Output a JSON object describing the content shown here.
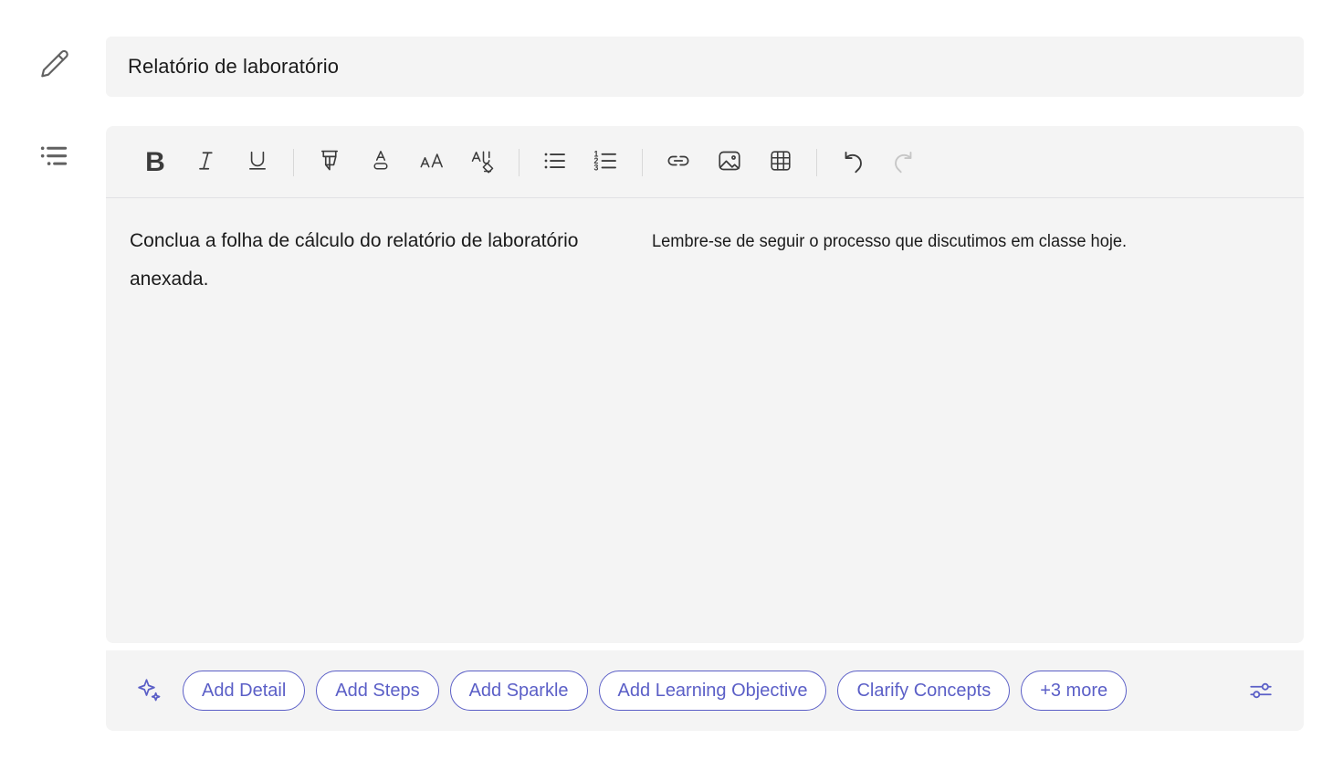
{
  "rail": {
    "edit_icon": "pencil-icon",
    "outline_icon": "bulleted-outline-icon"
  },
  "title_field": {
    "value": "Relatório de laboratório",
    "placeholder": "Título"
  },
  "toolbar": {
    "items": [
      {
        "name": "bold-button",
        "label": "B",
        "icon": "bold-icon",
        "disabled": false
      },
      {
        "name": "italic-button",
        "label": "",
        "icon": "italic-icon",
        "disabled": false
      },
      {
        "name": "underline-button",
        "label": "",
        "icon": "underline-icon",
        "disabled": false
      },
      {
        "name": "highlight-button",
        "label": "",
        "icon": "highlighter-icon",
        "disabled": false
      },
      {
        "name": "font-color-button",
        "label": "",
        "icon": "font-color-icon",
        "disabled": false
      },
      {
        "name": "font-size-button",
        "label": "",
        "icon": "font-size-icon",
        "disabled": false
      },
      {
        "name": "clear-formatting-button",
        "label": "",
        "icon": "clear-formatting-icon",
        "disabled": false
      },
      {
        "name": "bulleted-list-button",
        "label": "",
        "icon": "bulleted-list-icon",
        "disabled": false
      },
      {
        "name": "numbered-list-button",
        "label": "",
        "icon": "numbered-list-icon",
        "disabled": false
      },
      {
        "name": "insert-link-button",
        "label": "",
        "icon": "link-icon",
        "disabled": false
      },
      {
        "name": "insert-image-button",
        "label": "",
        "icon": "image-icon",
        "disabled": false
      },
      {
        "name": "insert-table-button",
        "label": "",
        "icon": "table-icon",
        "disabled": false
      },
      {
        "name": "undo-button",
        "label": "",
        "icon": "undo-icon",
        "disabled": false
      },
      {
        "name": "redo-button",
        "label": "",
        "icon": "redo-icon",
        "disabled": true
      }
    ]
  },
  "editor": {
    "paragraph_primary": "Conclua a folha de cálculo do relatório de laboratório anexada.",
    "paragraph_secondary": "Lembre-se de seguir o processo que discutimos em classe hoje."
  },
  "actions": {
    "sparkle_icon": "sparkle-icon",
    "settings_icon": "sliders-settings-icon",
    "chips": [
      {
        "label": "Add Detail"
      },
      {
        "label": "Add Steps"
      },
      {
        "label": "Add Sparkle"
      },
      {
        "label": "Add Learning Objective"
      },
      {
        "label": "Clarify Concepts"
      },
      {
        "label": "+3 more"
      }
    ]
  },
  "colors": {
    "accent": "#5b5fc7",
    "panel": "#f4f4f4",
    "text": "#1b1b1b",
    "icon": "#3b3b3b",
    "icon_disabled": "#c6c6c6",
    "divider": "#e0e0e4"
  }
}
